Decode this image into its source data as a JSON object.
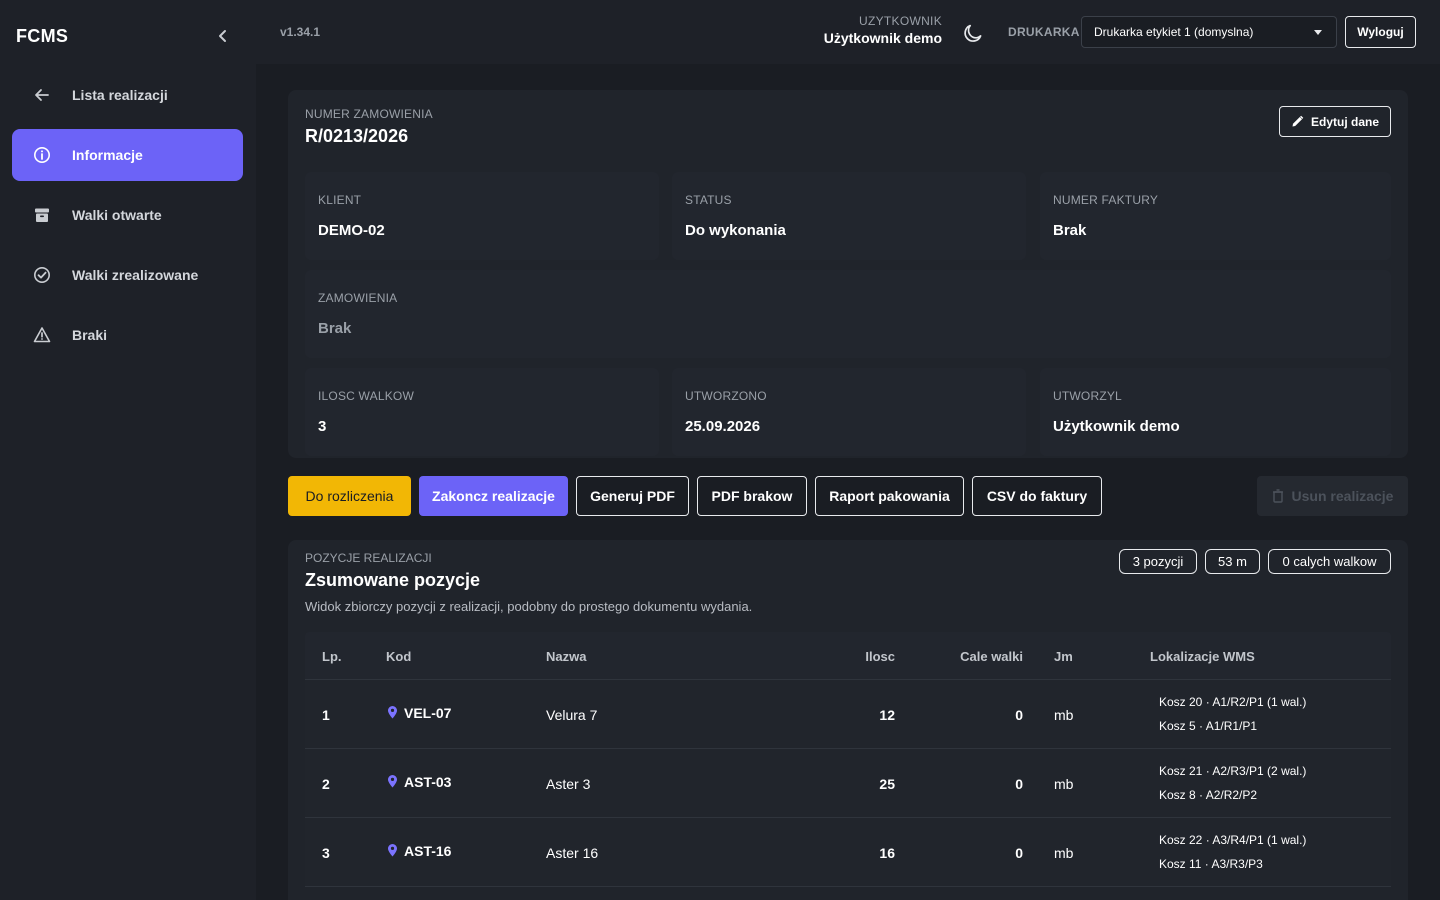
{
  "app": {
    "brand": "FCMS",
    "version": "v1.34.1"
  },
  "sidebar": {
    "items": [
      {
        "label": "Lista realizacji",
        "icon": "arrow-left-icon"
      },
      {
        "label": "Informacje",
        "icon": "info-icon",
        "active": true
      },
      {
        "label": "Walki otwarte",
        "icon": "archive-icon"
      },
      {
        "label": "Walki zrealizowane",
        "icon": "check-circle-icon"
      },
      {
        "label": "Braki",
        "icon": "warning-icon"
      }
    ]
  },
  "topbar": {
    "user_label": "UZYTKOWNIK",
    "user_name": "Użytkownik demo",
    "printer_label": "DRUKARKA",
    "printer_value": "Drukarka etykiet 1 (domyslna)",
    "logout_label": "Wyloguj"
  },
  "order": {
    "number_label": "NUMER ZAMOWIENIA",
    "number": "R/0213/2026",
    "edit_label": "Edytuj dane",
    "client_label": "KLIENT",
    "client": "DEMO-02",
    "status_label": "STATUS",
    "status": "Do wykonania",
    "invoice_label": "NUMER FAKTURY",
    "invoice": "Brak",
    "orders_label": "ZAMOWIENIA",
    "orders": "Brak",
    "rolls_label": "ILOSC WALKOW",
    "rolls": "3",
    "created_label": "UTWORZONO",
    "created": "25.09.2026",
    "creator_label": "UTWORZYL",
    "creator": "Użytkownik demo"
  },
  "actions": {
    "settle": "Do rozliczenia",
    "finish": "Zakoncz realizacje",
    "pdf": "Generuj PDF",
    "pdf_defects": "PDF brakow",
    "packing_report": "Raport pakowania",
    "csv_invoice": "CSV do faktury",
    "delete": "Usun realizacje"
  },
  "positions": {
    "label": "POZYCJE REALIZACJI",
    "title": "Zsumowane pozycje",
    "description": "Widok zbiorczy pozycji z realizacji, podobny do prostego dokumentu wydania.",
    "chips": [
      "3 pozycji",
      "53 m",
      "0 calych walkow"
    ],
    "columns": [
      "Lp.",
      "Kod",
      "Nazwa",
      "Ilosc",
      "Cale walki",
      "Jm",
      "Lokalizacje WMS"
    ],
    "rows": [
      {
        "lp": "1",
        "kod": "VEL-07",
        "nazwa": "Velura 7",
        "ilosc": "12",
        "cale": "0",
        "jm": "mb",
        "loc": [
          "Kosz 20 · A1/R2/P1 (1 wal.)",
          "Kosz 5 · A1/R1/P1"
        ]
      },
      {
        "lp": "2",
        "kod": "AST-03",
        "nazwa": "Aster 3",
        "ilosc": "25",
        "cale": "0",
        "jm": "mb",
        "loc": [
          "Kosz 21 · A2/R3/P1 (2 wal.)",
          "Kosz 8 · A2/R2/P2"
        ]
      },
      {
        "lp": "3",
        "kod": "AST-16",
        "nazwa": "Aster 16",
        "ilosc": "16",
        "cale": "0",
        "jm": "mb",
        "loc": [
          "Kosz 22 · A3/R4/P1 (1 wal.)",
          "Kosz 11 · A3/R3/P3"
        ]
      }
    ]
  },
  "colors": {
    "accent": "#6c63f7",
    "warning": "#f2b705",
    "background": "#1a1d23",
    "panel": "#20242b"
  }
}
